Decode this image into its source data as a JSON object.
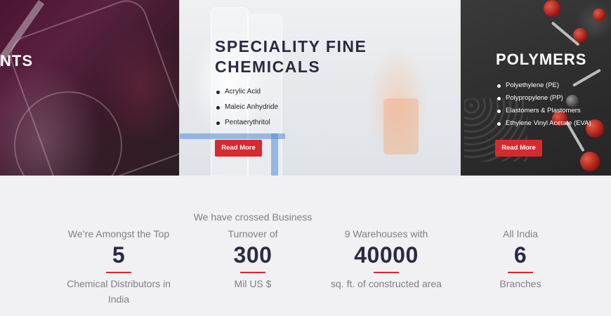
{
  "panels": {
    "left": {
      "title_fragment": "NTS"
    },
    "middle": {
      "title_line1": "SPECIALITY FINE",
      "title_line2": "CHEMICALS",
      "items": [
        "Acrylic Acid",
        "Maleic Anhydride",
        "Pentaerythritol"
      ],
      "button_label": "Read More"
    },
    "right": {
      "title": "POLYMERS",
      "items": [
        "Polyethylene (PE)",
        "Polypropylene (PP)",
        "Elastomers & Plastomers",
        "Ethylene Vinyl Acetate (EVA)"
      ],
      "button_label": "Read More"
    }
  },
  "stats": [
    {
      "pre": "We’re Amongst the Top",
      "number": "5",
      "post_line1": "Chemical Distributors in",
      "post_line2": "India"
    },
    {
      "pre_line1": "We have crossed Business",
      "pre_line2": "Turnover of",
      "number": "300",
      "post_line1": "Mil US $"
    },
    {
      "pre": "9 Warehouses with",
      "number": "40000",
      "post_line1": "sq. ft. of constructed area"
    },
    {
      "pre": "All India",
      "number": "6",
      "post_line1": "Branches"
    }
  ],
  "colors": {
    "accent": "#d8292f",
    "heading": "#2b2a44",
    "muted_text": "#7e7e86",
    "section_bg": "#f1f1f4"
  }
}
